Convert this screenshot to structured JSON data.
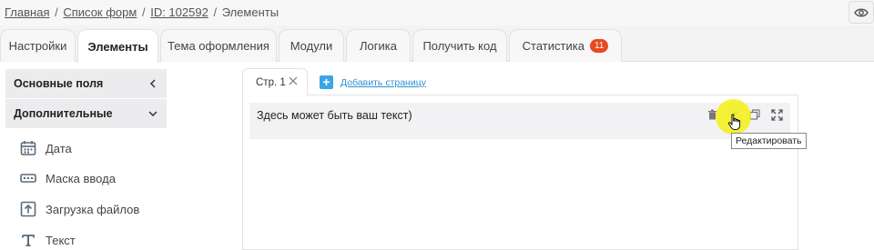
{
  "breadcrumb": {
    "home": "Главная",
    "forms": "Список форм",
    "id_link": "ID: 102592",
    "current": "Элементы",
    "separator": "/"
  },
  "preview_icon": "eye-icon",
  "tabs": [
    {
      "label": "Настройки",
      "active": false
    },
    {
      "label": "Элементы",
      "active": true
    },
    {
      "label": "Тема оформления",
      "active": false
    },
    {
      "label": "Модули",
      "active": false
    },
    {
      "label": "Логика",
      "active": false
    },
    {
      "label": "Получить код",
      "active": false
    },
    {
      "label": "Статистика",
      "active": false,
      "badge": "11"
    }
  ],
  "sidebar": {
    "sections": [
      {
        "label": "Основные поля",
        "state": "collapsed",
        "icon": "chevron-left-icon"
      },
      {
        "label": "Дополнительные",
        "state": "expanded",
        "icon": "chevron-down-icon"
      }
    ],
    "items": [
      {
        "label": "Дата",
        "icon": "calendar-icon"
      },
      {
        "label": "Маска ввода",
        "icon": "input-mask-icon"
      },
      {
        "label": "Загрузка файлов",
        "icon": "upload-icon"
      },
      {
        "label": "Текст",
        "icon": "text-icon"
      }
    ]
  },
  "pages": {
    "active_tab": "Стр. 1",
    "add_page": "Добавить страницу"
  },
  "element": {
    "text": "Здесь может быть ваш текст)",
    "tools": [
      "trash-icon",
      "edit-icon",
      "copy-icon",
      "expand-icon"
    ],
    "tooltip": "Редактировать"
  },
  "colors": {
    "accent_blue": "#3aa6e6",
    "badge": "#e8491d",
    "highlight": "#f5f014"
  }
}
